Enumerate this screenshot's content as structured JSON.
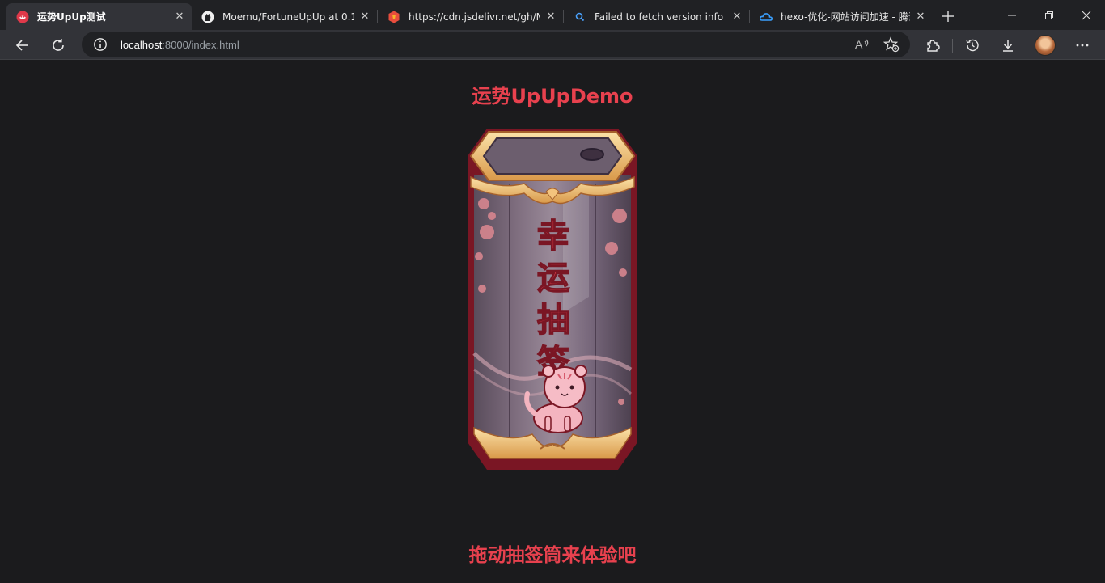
{
  "browser": {
    "tabs": [
      {
        "title": "运势UpUp测试",
        "icon": "app-icon",
        "active": true
      },
      {
        "title": "Moemu/FortuneUpUp at 0.1",
        "icon": "github-icon",
        "active": false
      },
      {
        "title": "https://cdn.jsdelivr.net/gh/Moe",
        "icon": "jsdelivr-icon",
        "active": false
      },
      {
        "title": "Failed to fetch version info for",
        "icon": "search-icon",
        "active": false
      },
      {
        "title": "hexo-优化-网站访问加速 - 腾讯",
        "icon": "cloud-icon",
        "active": false
      }
    ],
    "address": {
      "host": "localhost",
      "rest": ":8000/index.html"
    },
    "read_aloud_label": "A"
  },
  "page": {
    "title": "运势UpUpDemo",
    "cylinder_label": [
      "幸",
      "运",
      "抽",
      "签"
    ],
    "hint": "拖动抽签筒来体验吧"
  },
  "colors": {
    "accent_red": "#e8414e",
    "background": "#1b1b1d",
    "cylinder_gold": "#e9b864"
  }
}
